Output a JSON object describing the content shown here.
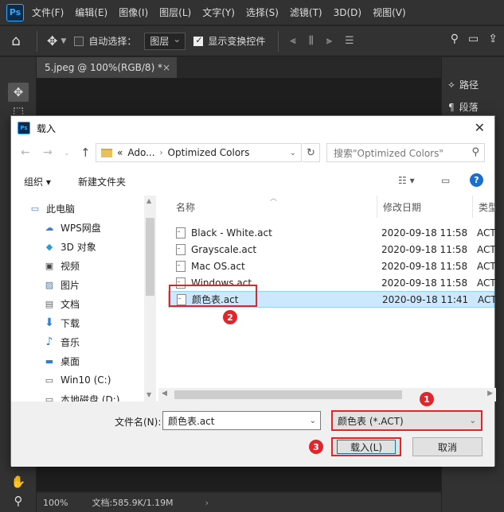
{
  "ps": {
    "logo": "Ps",
    "menu": [
      "文件(F)",
      "编辑(E)",
      "图像(I)",
      "图层(L)",
      "文字(Y)",
      "选择(S)",
      "滤镜(T)",
      "3D(D)",
      "视图(V)"
    ],
    "options": {
      "auto_select_label": "自动选择：",
      "layer_select": "图层",
      "show_transform_label": "显示变换控件"
    },
    "doc_tab": "5.jpeg @ 100%(RGB/8) *",
    "panels": {
      "paths": "路径",
      "paragraphs": "段落"
    },
    "status": {
      "zoom": "100%",
      "doc_info": "文档:585.9K/1.19M"
    }
  },
  "dialog": {
    "title": "载入",
    "address": {
      "sep": "«",
      "part1": "Ado...",
      "part2": "Optimized Colors"
    },
    "search_placeholder": "搜索\"Optimized Colors\"",
    "toolbar": {
      "organize": "组织 ▾",
      "new_folder": "新建文件夹"
    },
    "nav": [
      {
        "label": "此电脑",
        "icon": "computer-icon"
      },
      {
        "label": "WPS网盘",
        "icon": "cloud-icon"
      },
      {
        "label": "3D 对象",
        "icon": "cube-icon"
      },
      {
        "label": "视频",
        "icon": "video-icon"
      },
      {
        "label": "图片",
        "icon": "picture-icon"
      },
      {
        "label": "文档",
        "icon": "document-icon"
      },
      {
        "label": "下载",
        "icon": "download-icon"
      },
      {
        "label": "音乐",
        "icon": "music-icon"
      },
      {
        "label": "桌面",
        "icon": "desktop-icon"
      },
      {
        "label": "Win10 (C:)",
        "icon": "drive-icon"
      },
      {
        "label": "本地磁盘 (D:)",
        "icon": "drive-icon"
      }
    ],
    "columns": {
      "name": "名称",
      "date": "修改日期",
      "type": "类型"
    },
    "files": [
      {
        "name": "Black - White.act",
        "date": "2020-09-18 11:58",
        "type": "ACT"
      },
      {
        "name": "Grayscale.act",
        "date": "2020-09-18 11:58",
        "type": "ACT"
      },
      {
        "name": "Mac OS.act",
        "date": "2020-09-18 11:58",
        "type": "ACT"
      },
      {
        "name": "Windows.act",
        "date": "2020-09-18 11:58",
        "type": "ACT"
      },
      {
        "name": "颜色表.act",
        "date": "2020-09-18 11:41",
        "type": "ACT"
      }
    ],
    "filename_label": "文件名(N):",
    "filename_value": "颜色表.act",
    "filetype_value": "颜色表 (*.ACT)",
    "load_button": "载入(L)",
    "cancel_button": "取消"
  },
  "annotations": {
    "step1": "1",
    "step2": "2",
    "step3": "3"
  },
  "colors": {
    "highlight": "#e0262b",
    "selection": "#cce8ff",
    "ps_blue": "#31a8ff"
  }
}
